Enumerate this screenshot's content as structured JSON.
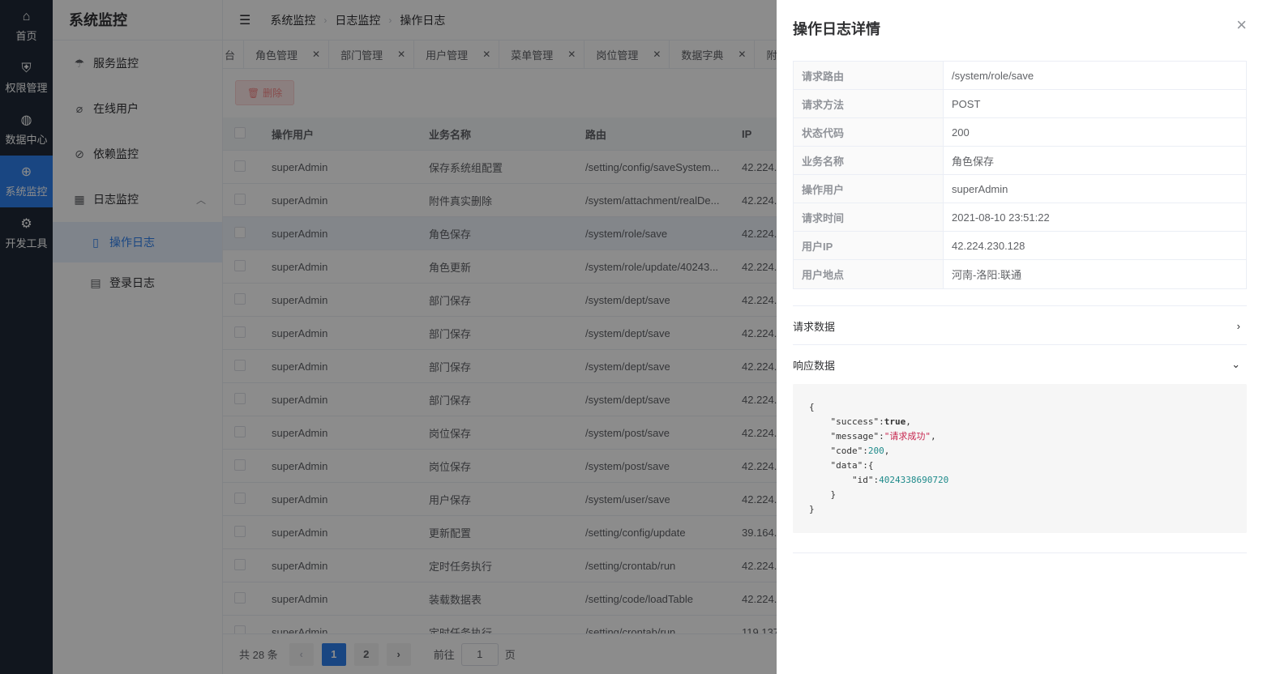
{
  "rail": [
    {
      "icon": "home-icon",
      "glyph": "⌂",
      "label": "首页"
    },
    {
      "icon": "shield-icon",
      "glyph": "⛨",
      "label": "权限管理"
    },
    {
      "icon": "database-icon",
      "glyph": "◍",
      "label": "数据中心"
    },
    {
      "icon": "monitor-icon",
      "glyph": "⊕",
      "label": "系统监控"
    },
    {
      "icon": "gear-icon",
      "glyph": "⚙",
      "label": "开发工具"
    }
  ],
  "menu": {
    "title": "系统监控",
    "items": [
      "服务监控",
      "在线用户",
      "依赖监控",
      "日志监控"
    ],
    "sub": [
      "操作日志",
      "登录日志"
    ]
  },
  "breadcrumb": [
    "系统监控",
    "日志监控",
    "操作日志"
  ],
  "tabs": {
    "cut": "台",
    "items": [
      "角色管理",
      "部门管理",
      "用户管理",
      "菜单管理",
      "岗位管理",
      "数据字典",
      "附件管理"
    ]
  },
  "toolbar": {
    "delete_label": "删除"
  },
  "table": {
    "headers": [
      "操作用户",
      "业务名称",
      "路由",
      "IP"
    ],
    "rows": [
      [
        "superAdmin",
        "保存系统组配置",
        "/setting/config/saveSystem...",
        "42.224."
      ],
      [
        "superAdmin",
        "附件真实删除",
        "/system/attachment/realDe...",
        "42.224."
      ],
      [
        "superAdmin",
        "角色保存",
        "/system/role/save",
        "42.224."
      ],
      [
        "superAdmin",
        "角色更新",
        "/system/role/update/40243...",
        "42.224."
      ],
      [
        "superAdmin",
        "部门保存",
        "/system/dept/save",
        "42.224."
      ],
      [
        "superAdmin",
        "部门保存",
        "/system/dept/save",
        "42.224."
      ],
      [
        "superAdmin",
        "部门保存",
        "/system/dept/save",
        "42.224."
      ],
      [
        "superAdmin",
        "部门保存",
        "/system/dept/save",
        "42.224."
      ],
      [
        "superAdmin",
        "岗位保存",
        "/system/post/save",
        "42.224."
      ],
      [
        "superAdmin",
        "岗位保存",
        "/system/post/save",
        "42.224."
      ],
      [
        "superAdmin",
        "用户保存",
        "/system/user/save",
        "42.224."
      ],
      [
        "superAdmin",
        "更新配置",
        "/setting/config/update",
        "39.164."
      ],
      [
        "superAdmin",
        "定时任务执行",
        "/setting/crontab/run",
        "42.224."
      ],
      [
        "superAdmin",
        "装载数据表",
        "/setting/code/loadTable",
        "42.224."
      ],
      [
        "superAdmin",
        "定时任务执行",
        "/setting/crontab/run",
        "119.137"
      ]
    ],
    "highlight_row": 3
  },
  "pager": {
    "total": "共 28 条",
    "prev": "‹",
    "next": "›",
    "pages": [
      "1",
      "2"
    ],
    "goto_label": "前往",
    "goto_value": "1",
    "page_suffix": "页"
  },
  "drawer": {
    "title": "操作日志详情",
    "close": "×",
    "fields": [
      {
        "k": "请求路由",
        "v": "/system/role/save"
      },
      {
        "k": "请求方法",
        "v": "POST"
      },
      {
        "k": "状态代码",
        "v": "200"
      },
      {
        "k": "业务名称",
        "v": "角色保存"
      },
      {
        "k": "操作用户",
        "v": "superAdmin"
      },
      {
        "k": "请求时间",
        "v": "2021-08-10 23:51:22"
      },
      {
        "k": "用户IP",
        "v": "42.224.230.128"
      },
      {
        "k": "用户地点",
        "v": "河南-洛阳:联通"
      }
    ],
    "request_label": "请求数据",
    "response_label": "响应数据",
    "response": {
      "success_key": "\"success\"",
      "success_val": "true",
      "message_key": "\"message\"",
      "message_val": "\"请求成功\"",
      "code_key": "\"code\"",
      "code_val": "200",
      "data_key": "\"data\"",
      "id_key": "\"id\"",
      "id_val": "4024338690720"
    }
  },
  "colors": {
    "accent": "#2f80ed",
    "rail_bg": "#1f2937",
    "danger": "#f56c6c"
  }
}
